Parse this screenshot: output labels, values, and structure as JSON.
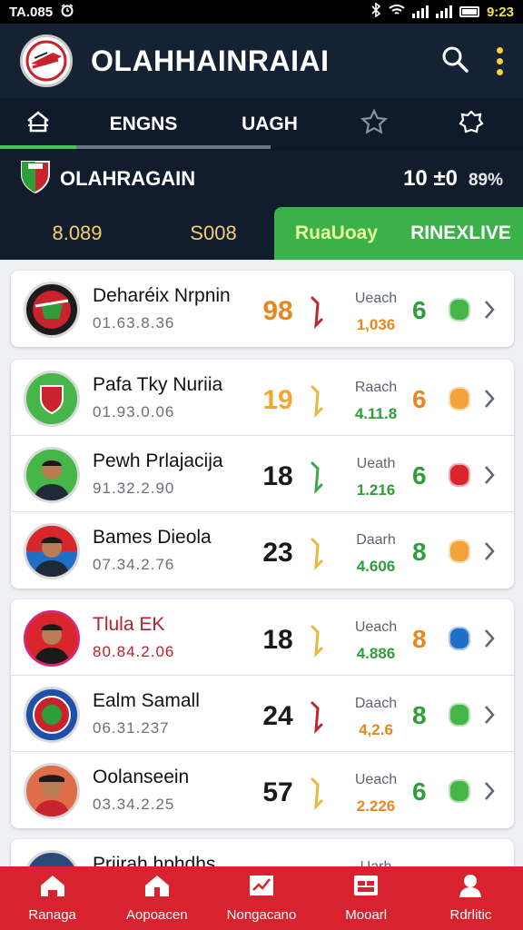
{
  "status": {
    "time": "TA.085",
    "clock": "9:23"
  },
  "app": {
    "title": "OLAHHAINRAIAI"
  },
  "tabs": [
    {
      "label": "ENGNS"
    },
    {
      "label": "UAGH"
    }
  ],
  "league": {
    "name": "OLAHRAGAIN",
    "score": "10 ±0",
    "percent": "89%"
  },
  "filters": {
    "value1": "8.089",
    "value2": "S008",
    "btn_active": "RuaUoay",
    "btn_live": "RINEXLIVE"
  },
  "players": [
    {
      "name": "Deharéix Nrpnin",
      "date": "01.63.8.36",
      "score": "98",
      "score_color": "#e8871e",
      "arrow_color": "#c0262d",
      "label": "Ueach",
      "value": "1,036",
      "value_color": "#e8871e",
      "rank": "6",
      "rank_color": "#2e9e3a",
      "dot_color": "#46b649"
    },
    {
      "name": "Pafa Tky Nuriia",
      "date": "01.93.0.06",
      "score": "19",
      "score_color": "#f0a830",
      "arrow_color": "#e8b93a",
      "label": "Raach",
      "value": "4.11.8",
      "value_color": "#2e9e3a",
      "rank": "6",
      "rank_color": "#e8871e",
      "dot_color": "#f2a43a"
    },
    {
      "name": "Pewh Prlajacija",
      "date": "91.32.2.90",
      "score": "18",
      "score_color": "#1a1a1a",
      "arrow_color": "#3aa84a",
      "label": "Ueath",
      "value": "1.216",
      "value_color": "#2e9e3a",
      "rank": "6",
      "rank_color": "#2e9e3a",
      "dot_color": "#d9262d"
    },
    {
      "name": "Bames Dieola",
      "date": "07.34.2.76",
      "score": "23",
      "score_color": "#1a1a1a",
      "arrow_color": "#e8b93a",
      "label": "Daarh",
      "value": "4.606",
      "value_color": "#2e9e3a",
      "rank": "8",
      "rank_color": "#2e9e3a",
      "dot_color": "#f2a43a"
    },
    {
      "name": "Tlula EK",
      "date": "80.84.2.06",
      "name_color": "#b0232b",
      "date_color": "#b0232b",
      "score": "18",
      "score_color": "#1a1a1a",
      "arrow_color": "#e8b93a",
      "label": "Ueach",
      "value": "4.886",
      "value_color": "#2e9e3a",
      "rank": "8",
      "rank_color": "#e8871e",
      "dot_color": "#1f6fc6"
    },
    {
      "name": "Ealm Samall",
      "date": "06.31.237",
      "score": "24",
      "score_color": "#1a1a1a",
      "arrow_color": "#c0262d",
      "label": "Daach",
      "value": "4,2.6",
      "value_color": "#e8871e",
      "rank": "8",
      "rank_color": "#2e9e3a",
      "dot_color": "#46b649"
    },
    {
      "name": "Oolanseein",
      "date": "03.34.2.25",
      "score": "57",
      "score_color": "#1a1a1a",
      "arrow_color": "#e8b93a",
      "label": "Ueach",
      "value": "2.226",
      "value_color": "#e8871e",
      "rank": "6",
      "rank_color": "#2e9e3a",
      "dot_color": "#46b649"
    },
    {
      "name": "Priirah hphdhs",
      "label": "Uarh"
    }
  ],
  "bottom_nav": [
    {
      "label": "Ranaga",
      "icon": "home-icon"
    },
    {
      "label": "Aopoacen",
      "icon": "house-icon"
    },
    {
      "label": "Nongacano",
      "icon": "chart-icon"
    },
    {
      "label": "Mooarl",
      "icon": "calendar-icon"
    },
    {
      "label": "Rdrlitic",
      "icon": "profile-icon"
    }
  ]
}
